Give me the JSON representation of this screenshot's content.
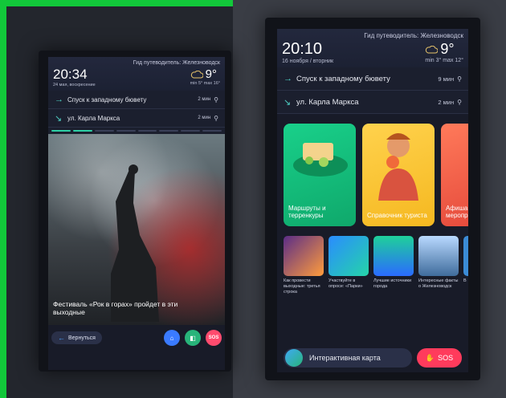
{
  "kiosk_small": {
    "guide": "Гид путеводитель: Железноводск",
    "time": "20:34",
    "date": "24 мая, воскресение",
    "temp": "9°",
    "minmax": "min 5° max 16°",
    "routes": [
      {
        "label": "Спуск к западному бювету",
        "mins": "2 мин"
      },
      {
        "label": "ул. Карла Маркса",
        "mins": "2 мин"
      }
    ],
    "caption": "Фестиваль «Рок в горах» пройдет в эти выходные",
    "back_label": "Вернуться",
    "sos_label": "SOS"
  },
  "kiosk_large": {
    "guide": "Гид путеводитель: Железноводск",
    "time": "20:10",
    "date": "16 ноября / вторник",
    "temp": "9°",
    "minmax": "min 3° max 12°",
    "routes": [
      {
        "label": "Спуск к западному бювету",
        "mins": "9 мин"
      },
      {
        "label": "ул. Карла Маркса",
        "mins": "2 мин"
      }
    ],
    "cards": [
      {
        "title": "Маршруты и терренкуры",
        "color": "#15c982"
      },
      {
        "title": "Справочник туриста",
        "color": "#ffcc3d"
      },
      {
        "title": "Афиша меропр",
        "color": "#f36a52"
      }
    ],
    "tiles": [
      {
        "title": "Как провести выходные: третья строка"
      },
      {
        "title": "Участвуйте в опросе: «Парки»"
      },
      {
        "title": "Лучшие источники города"
      },
      {
        "title": "Интересные факты о Железноводск"
      },
      {
        "title": "В"
      }
    ],
    "map_label": "Интерактивная карта",
    "sos_label": "SOS"
  },
  "icons": [
    "arrow-right-icon",
    "arrow-down-right-icon",
    "cloud-moon-icon",
    "walk-icon",
    "home-icon",
    "map-icon",
    "hand-icon"
  ]
}
